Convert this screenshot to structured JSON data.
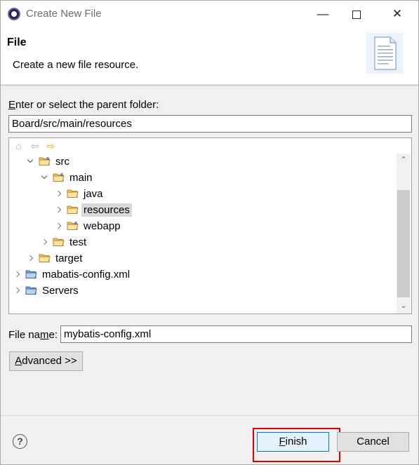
{
  "window": {
    "title": "Create New File",
    "minimize": "—",
    "close": "✕"
  },
  "banner": {
    "title": "File",
    "description": "Create a new file resource."
  },
  "parent": {
    "label_pre": "",
    "label_mnemonic": "E",
    "label_post": "nter or select the parent folder:",
    "value": "Board/src/main/resources"
  },
  "tree": {
    "nav": {
      "home": "⌂",
      "back": "⇦",
      "forward": "⇨"
    },
    "items": [
      {
        "label": "src",
        "expanded": true
      },
      {
        "label": "main",
        "expanded": true
      },
      {
        "label": "java",
        "expanded": false
      },
      {
        "label": "resources",
        "expanded": false,
        "selected": true
      },
      {
        "label": "webapp",
        "expanded": false
      },
      {
        "label": "test",
        "expanded": false
      },
      {
        "label": "target",
        "expanded": false
      },
      {
        "label": "mabatis-config.xml",
        "expanded": false
      },
      {
        "label": "Servers",
        "expanded": false
      }
    ],
    "scroll_up": "⌃",
    "scroll_down": "⌄"
  },
  "filename": {
    "label_pre": "File na",
    "label_mnemonic": "m",
    "label_post": "e:",
    "value": "mybatis-config.xml"
  },
  "buttons": {
    "advanced_mnemonic": "A",
    "advanced_rest": "dvanced >>",
    "finish_mnemonic": "F",
    "finish_rest": "inish",
    "cancel": "Cancel",
    "help": "?"
  },
  "colors": {
    "selection": "#d9d9d9",
    "focus_border": "#0078d7",
    "annotation": "#e00000",
    "folder": "#e8b64b"
  }
}
